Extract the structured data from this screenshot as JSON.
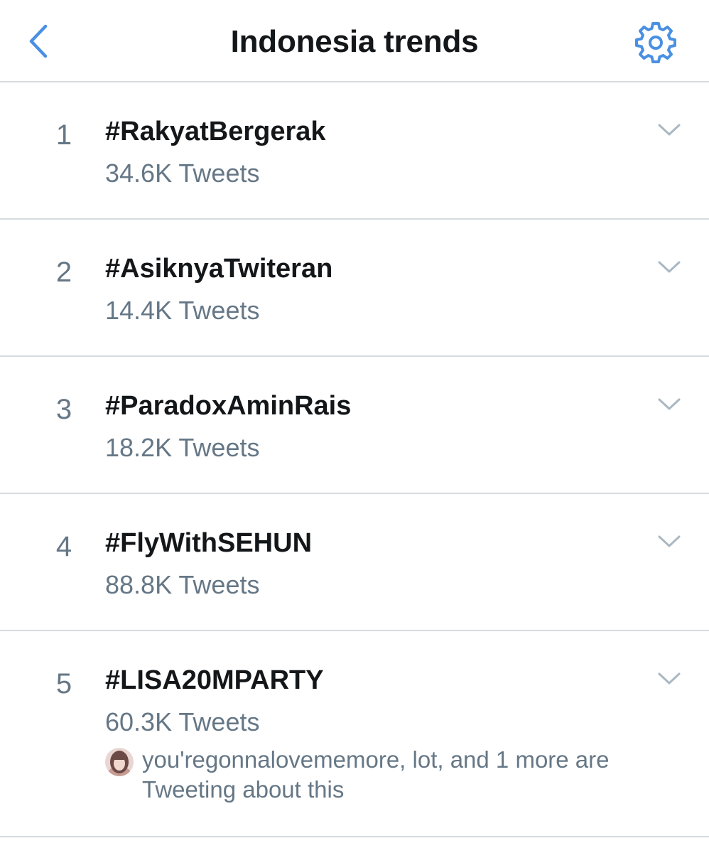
{
  "header": {
    "title": "Indonesia trends",
    "back_icon": "chevron-left-icon",
    "settings_icon": "gear-icon",
    "accent_color": "#4a90e2"
  },
  "trends": [
    {
      "rank": "1",
      "name": "#RakyatBergerak",
      "count": "34.6K Tweets"
    },
    {
      "rank": "2",
      "name": "#AsiknyaTwiteran",
      "count": "14.4K Tweets"
    },
    {
      "rank": "3",
      "name": "#ParadoxAminRais",
      "count": "18.2K Tweets"
    },
    {
      "rank": "4",
      "name": "#FlyWithSEHUN",
      "count": "88.8K Tweets"
    },
    {
      "rank": "5",
      "name": "#LISA20MPARTY",
      "count": "60.3K Tweets",
      "social_context": "you'regonnalovememore, lot, and 1 more are Tweeting about this"
    }
  ],
  "colors": {
    "primary_text": "#14171a",
    "secondary_text": "#657786",
    "divider": "#d6dbdf",
    "chevron": "#aab8c2"
  }
}
